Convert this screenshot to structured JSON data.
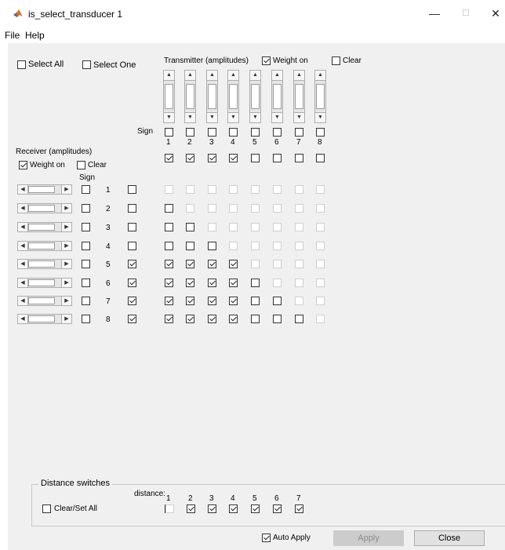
{
  "window": {
    "title": "is_select_transducer 1",
    "minimize": "—",
    "maximize": "☐",
    "close": "✕"
  },
  "menu": [
    "File",
    "Help"
  ],
  "top": {
    "select_all": "Select All",
    "select_one": "Select One",
    "transmitter_label": "Transmitter (amplitudes)",
    "tx_weight_on": "Weight on",
    "tx_clear": "Clear",
    "tx_weight_checked": true,
    "tx_clear_checked": false
  },
  "sign_label": "Sign",
  "transmitters": [
    "1",
    "2",
    "3",
    "4",
    "5",
    "6",
    "7",
    "8"
  ],
  "tx_sign": [
    false,
    false,
    false,
    false,
    false,
    false,
    false,
    false
  ],
  "tx_enabled": [
    true,
    true,
    true,
    true,
    false,
    false,
    false,
    false
  ],
  "receiver": {
    "label": "Receiver (amplitudes)",
    "weight_on": "Weight on",
    "clear": "Clear",
    "sign": "Sign",
    "weight_checked": true,
    "clear_checked": false
  },
  "receivers": [
    {
      "num": "1",
      "sign": false,
      "enabled": false,
      "grid": [
        "d",
        "d",
        "d",
        "d",
        "d",
        "d",
        "d",
        "d"
      ]
    },
    {
      "num": "2",
      "sign": false,
      "enabled": false,
      "grid": [
        "u",
        "d",
        "d",
        "d",
        "d",
        "d",
        "d",
        "d"
      ]
    },
    {
      "num": "3",
      "sign": false,
      "enabled": false,
      "grid": [
        "u",
        "u",
        "d",
        "d",
        "d",
        "d",
        "d",
        "d"
      ]
    },
    {
      "num": "4",
      "sign": false,
      "enabled": false,
      "grid": [
        "u",
        "u",
        "u",
        "d",
        "d",
        "d",
        "d",
        "d"
      ]
    },
    {
      "num": "5",
      "sign": false,
      "enabled": true,
      "grid": [
        "c",
        "c",
        "c",
        "c",
        "d",
        "d",
        "d",
        "d"
      ]
    },
    {
      "num": "6",
      "sign": false,
      "enabled": true,
      "grid": [
        "c",
        "c",
        "c",
        "c",
        "u",
        "d",
        "d",
        "d"
      ]
    },
    {
      "num": "7",
      "sign": false,
      "enabled": true,
      "grid": [
        "c",
        "c",
        "c",
        "c",
        "u",
        "u",
        "d",
        "d"
      ]
    },
    {
      "num": "8",
      "sign": false,
      "enabled": true,
      "grid": [
        "c",
        "c",
        "c",
        "c",
        "u",
        "u",
        "u",
        "d"
      ]
    }
  ],
  "distance": {
    "group_title": "Distance switches",
    "label": "distance:",
    "clear_set_all": "Clear/Set All",
    "values": [
      "1",
      "2",
      "3",
      "4",
      "5",
      "6",
      "7"
    ],
    "zero_checked": false,
    "checked": [
      true,
      true,
      true,
      true,
      true,
      true,
      true
    ]
  },
  "footer": {
    "auto_apply": "Auto Apply",
    "auto_apply_checked": true,
    "apply": "Apply",
    "close": "Close"
  }
}
